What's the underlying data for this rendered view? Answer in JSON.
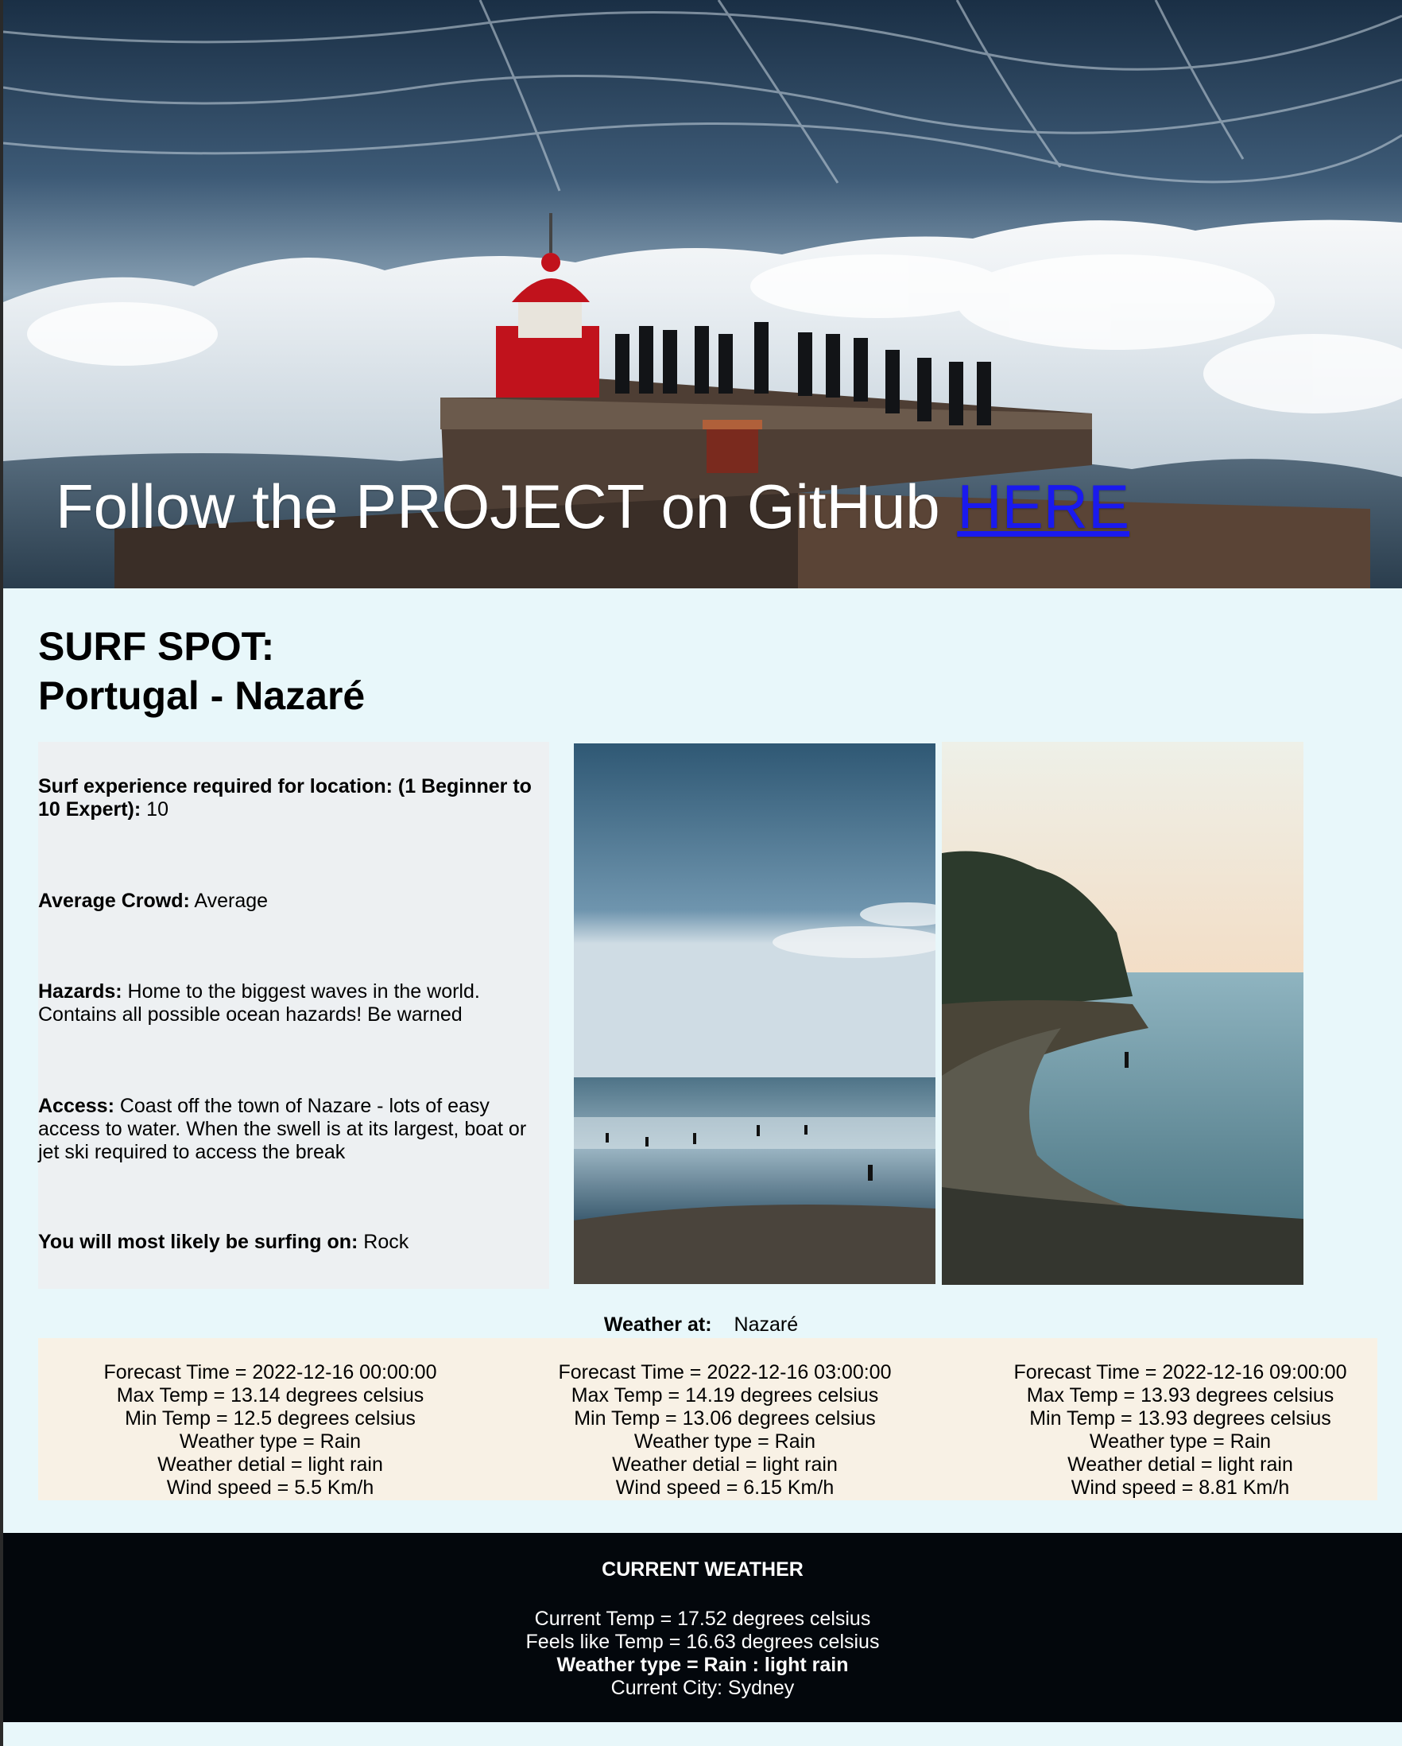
{
  "hero": {
    "title_text": "Follow the PROJECT on GitHub ",
    "link_label": "HERE"
  },
  "spot": {
    "heading_line1": "SURF SPOT:",
    "heading_line2": "Portugal - Nazaré"
  },
  "info": {
    "experience": {
      "label": "Surf experience required for location: (1 Beginner to 10 Expert):",
      "value": " 10"
    },
    "crowd": {
      "label": "Average Crowd:",
      "value": " Average"
    },
    "hazards": {
      "label": "Hazards:",
      "value": " Home to the biggest waves in the world. Contains all possible ocean hazards! Be warned"
    },
    "access": {
      "label": "Access:",
      "value": " Coast off the town of Nazare - lots of easy access to water. When the swell is at its largest, boat or jet ski required to access the break"
    },
    "surface": {
      "label": "You will most likely be surfing on:",
      "value": " Rock"
    }
  },
  "weather_at": {
    "label": "Weather at:",
    "location": "Nazaré"
  },
  "forecasts": [
    {
      "time": "Forecast Time = 2022-12-16 00:00:00",
      "max": "Max Temp = 13.14 degrees celsius",
      "min": "Min Temp = 12.5 degrees celsius",
      "type": "Weather type = Rain",
      "detail": "Weather detial = light rain",
      "wind": "Wind speed = 5.5 Km/h"
    },
    {
      "time": "Forecast Time = 2022-12-16 03:00:00",
      "max": "Max Temp = 14.19 degrees celsius",
      "min": "Min Temp = 13.06 degrees celsius",
      "type": "Weather type = Rain",
      "detail": "Weather detial = light rain",
      "wind": "Wind speed = 6.15 Km/h"
    },
    {
      "time": "Forecast Time = 2022-12-16 09:00:00",
      "max": "Max Temp = 13.93 degrees celsius",
      "min": "Min Temp = 13.93 degrees celsius",
      "type": "Weather type = Rain",
      "detail": "Weather detial = light rain",
      "wind": "Wind speed = 8.81 Km/h"
    }
  ],
  "current_weather": {
    "title": "CURRENT WEATHER",
    "temp": "Current Temp = 17.52 degrees celsius",
    "feels_like": "Feels like Temp = 16.63 degrees celsius",
    "type": "Weather type = Rain : light rain",
    "city": "Current City: Sydney"
  },
  "colors": {
    "page_bg": "#e8f7fa",
    "info_bg": "#edf0f2",
    "forecast_bg": "#f8f1e5",
    "current_bg": "#03070c",
    "link": "#1a1aee"
  }
}
